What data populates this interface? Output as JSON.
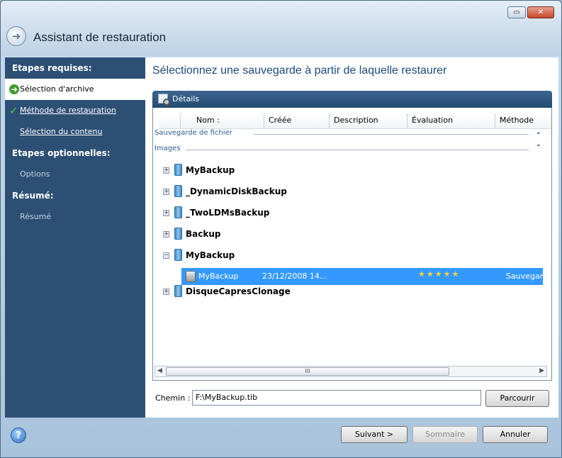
{
  "window": {
    "title": "Assistant de restauration",
    "controls": {
      "minimize": "▭",
      "close": "✕"
    }
  },
  "sidebar": {
    "required_header": "Etapes requises:",
    "required": [
      {
        "label": "Sélection d'archive",
        "state": "current",
        "icon": "green-arrow-icon"
      },
      {
        "label": "Méthode de restauration",
        "state": "done",
        "icon": "green-check-icon"
      },
      {
        "label": "Sélection du contenu",
        "state": "link"
      }
    ],
    "optional_header": "Etapes optionnelles:",
    "optional": [
      {
        "label": "Options",
        "state": "disabled"
      }
    ],
    "summary_header": "Résumé:",
    "summary": [
      {
        "label": "Résumé",
        "state": "disabled"
      }
    ]
  },
  "main": {
    "title": "Sélectionnez une sauvegarde à partir de laquelle restaurer",
    "details_label": "Détails",
    "columns": [
      "Nom :",
      "Créée",
      "Description",
      "Évaluation",
      "Méthode"
    ],
    "group_file": "Sauvegarde de fichier",
    "group_images": "Images",
    "items": [
      {
        "name": "MyBackup",
        "expanded": false
      },
      {
        "name": "_DynamicDiskBackup",
        "expanded": false
      },
      {
        "name": "_TwoLDMsBackup",
        "expanded": false
      },
      {
        "name": "Backup",
        "expanded": false
      },
      {
        "name": "MyBackup",
        "expanded": true
      },
      {
        "name": "DisqueCapresClonage",
        "expanded": false
      }
    ],
    "selected_child": {
      "name": "MyBackup",
      "created": "23/12/2008 14...",
      "rating": 5,
      "stars": "★★★★★",
      "method": "Sauvegarde"
    },
    "scroll_grip": "III",
    "path_label": "Chemin :",
    "path_value": "F:\\MyBackup.tib",
    "browse_label": "Parcourir"
  },
  "footer": {
    "help_icon": "?",
    "next_label": "Suivant >",
    "summary_label": "Sommaire",
    "cancel_label": "Annuler"
  },
  "colors": {
    "sidebar_bg": "#2d4f74",
    "title_blue": "#1b4a7e",
    "selection": "#3399ff",
    "details_bar": "#2f5a86"
  }
}
